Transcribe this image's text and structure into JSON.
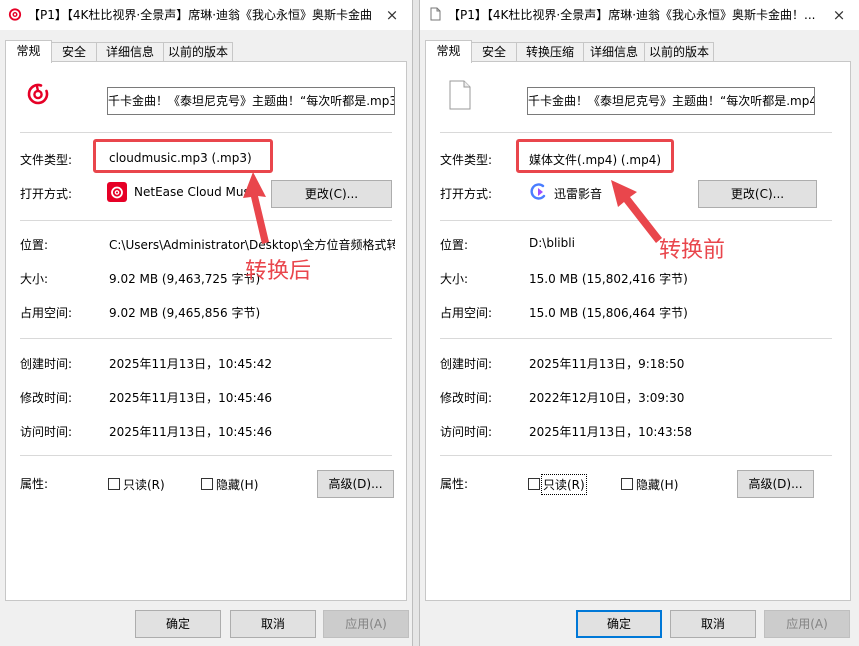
{
  "left": {
    "title": "【P1】【4K杜比视界·全景声】席琳·迪翁《我心永恒》奥斯卡金曲...",
    "close_icon": "×",
    "tabs": [
      "常规",
      "安全",
      "详细信息",
      "以前的版本"
    ],
    "filename": "千卡金曲！《泰坦尼克号》主题曲！“每次听都是.mp3",
    "file_type_label": "文件类型:",
    "file_type_value": "cloudmusic.mp3 (.mp3)",
    "open_with_label": "打开方式:",
    "open_with_value": "NetEase Cloud Music",
    "change_button": "更改(C)...",
    "location_label": "位置:",
    "location_value": "C:\\Users\\Administrator\\Desktop\\全方位音频格式转",
    "size_label": "大小:",
    "size_value": "9.02 MB (9,463,725 字节)",
    "disk_size_label": "占用空间:",
    "disk_size_value": "9.02 MB (9,465,856 字节)",
    "created_label": "创建时间:",
    "created_value": "2025年11月13日，10:45:42",
    "modified_label": "修改时间:",
    "modified_value": "2025年11月13日，10:45:46",
    "accessed_label": "访问时间:",
    "accessed_value": "2025年11月13日，10:45:46",
    "attributes_label": "属性:",
    "readonly_label": "只读(R)",
    "hidden_label": "隐藏(H)",
    "advanced_button": "高级(D)...",
    "ok_button": "确定",
    "cancel_button": "取消",
    "apply_button": "应用(A)",
    "annotation": "转换后"
  },
  "right": {
    "title": "【P1】【4K杜比视界·全景声】席琳·迪翁《我心永恒》奥斯卡金曲！...",
    "close_icon": "×",
    "tabs": [
      "常规",
      "安全",
      "转换压缩",
      "详细信息",
      "以前的版本"
    ],
    "filename": "千卡金曲！《泰坦尼克号》主题曲！“每次听都是.mp4",
    "file_type_label": "文件类型:",
    "file_type_value": "媒体文件(.mp4) (.mp4)",
    "open_with_label": "打开方式:",
    "open_with_value": "迅雷影音",
    "change_button": "更改(C)...",
    "location_label": "位置:",
    "location_value": "D:\\blibli",
    "size_label": "大小:",
    "size_value": "15.0 MB (15,802,416 字节)",
    "disk_size_label": "占用空间:",
    "disk_size_value": "15.0 MB (15,806,464 字节)",
    "created_label": "创建时间:",
    "created_value": "2025年11月13日，9:18:50",
    "modified_label": "修改时间:",
    "modified_value": "2022年12月10日，3:09:30",
    "accessed_label": "访问时间:",
    "accessed_value": "2025年11月13日，10:43:58",
    "attributes_label": "属性:",
    "readonly_label": "只读(R)",
    "hidden_label": "隐藏(H)",
    "advanced_button": "高级(D)...",
    "ok_button": "确定",
    "cancel_button": "取消",
    "apply_button": "应用(A)",
    "annotation": "转换前"
  },
  "colors": {
    "annotation_red": "#e9464c",
    "netease_red": "#e60026",
    "focus_blue": "#0078d7"
  }
}
